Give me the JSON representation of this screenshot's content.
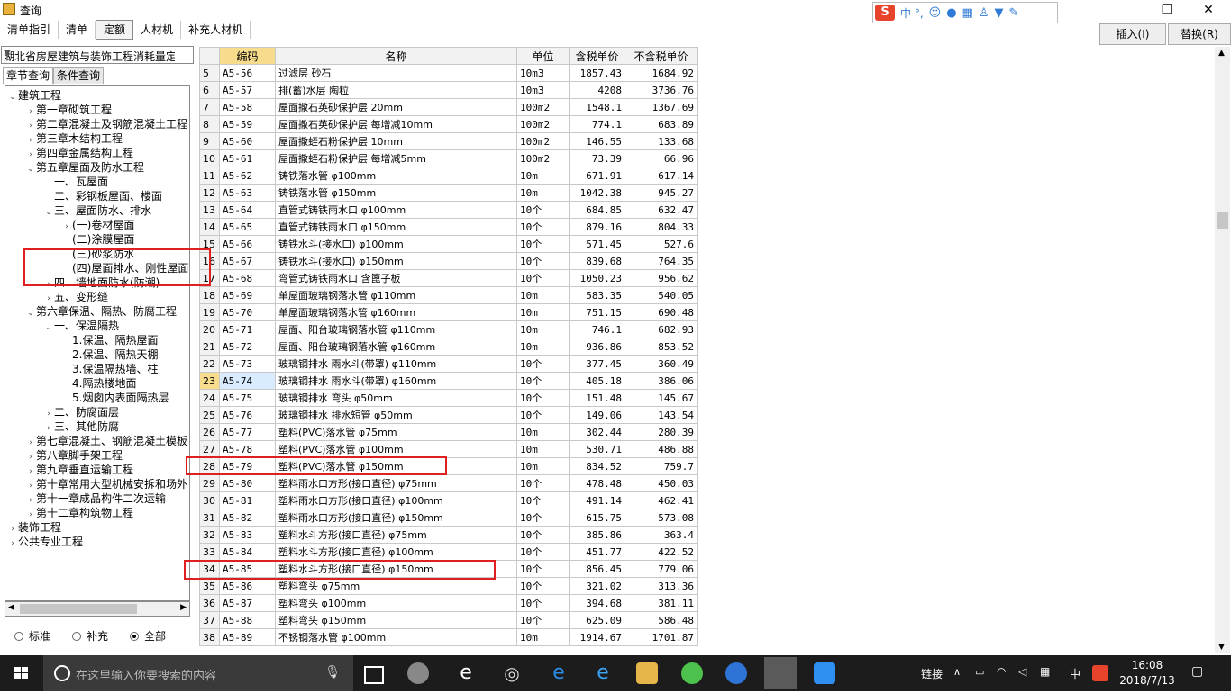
{
  "window": {
    "title": "查询"
  },
  "ime": {
    "brand": "S",
    "chars": "中 °,",
    "icons": [
      "emoji-icon",
      "mic-icon",
      "keyboard-icon",
      "user-icon",
      "shirt-icon",
      "wrench-icon"
    ]
  },
  "toolbar": {
    "tabs": [
      "清单指引",
      "清单",
      "定额",
      "人材机",
      "补充人材机"
    ],
    "active_tab": "定额",
    "insert_label": "插入(I)",
    "replace_label": "替换(R)"
  },
  "library": {
    "selected": "湖北省房屋建筑与装饰工程消耗量定"
  },
  "left_tabs": [
    "章节查询",
    "条件查询"
  ],
  "tree": [
    {
      "label": "建筑工程",
      "level": 0,
      "exp": "v"
    },
    {
      "label": "第一章砌筑工程",
      "level": 1,
      "exp": ">"
    },
    {
      "label": "第二章混凝土及钢筋混凝土工程",
      "level": 1,
      "exp": ">"
    },
    {
      "label": "第三章木结构工程",
      "level": 1,
      "exp": ">"
    },
    {
      "label": "第四章金属结构工程",
      "level": 1,
      "exp": ">"
    },
    {
      "label": "第五章屋面及防水工程",
      "level": 1,
      "exp": "v"
    },
    {
      "label": "一、瓦屋面",
      "level": 2,
      "exp": ""
    },
    {
      "label": "二、彩钢板屋面、楼面",
      "level": 2,
      "exp": ""
    },
    {
      "label": "三、屋面防水、排水",
      "level": 2,
      "exp": "v"
    },
    {
      "label": "(一)卷材屋面",
      "level": 3,
      "exp": ">"
    },
    {
      "label": "(二)涂膜屋面",
      "level": 3,
      "exp": ""
    },
    {
      "label": "(三)砂浆防水",
      "level": 3,
      "exp": ""
    },
    {
      "label": "(四)屋面排水、刚性屋面",
      "level": 3,
      "exp": ""
    },
    {
      "label": "四、墙地面防水(防潮)",
      "level": 2,
      "exp": ">"
    },
    {
      "label": "五、变形缝",
      "level": 2,
      "exp": ">"
    },
    {
      "label": "第六章保温、隔热、防腐工程",
      "level": 1,
      "exp": "v"
    },
    {
      "label": "一、保温隔热",
      "level": 2,
      "exp": "v"
    },
    {
      "label": "1.保温、隔热屋面",
      "level": 3,
      "exp": ""
    },
    {
      "label": "2.保温、隔热天棚",
      "level": 3,
      "exp": ""
    },
    {
      "label": "3.保温隔热墙、柱",
      "level": 3,
      "exp": ""
    },
    {
      "label": "4.隔热楼地面",
      "level": 3,
      "exp": ""
    },
    {
      "label": "5.烟囱内表面隔热层",
      "level": 3,
      "exp": ""
    },
    {
      "label": "二、防腐面层",
      "level": 2,
      "exp": ">"
    },
    {
      "label": "三、其他防腐",
      "level": 2,
      "exp": ">"
    },
    {
      "label": "第七章混凝土、钢筋混凝土模板",
      "level": 1,
      "exp": ">"
    },
    {
      "label": "第八章脚手架工程",
      "level": 1,
      "exp": ">"
    },
    {
      "label": "第九章垂直运输工程",
      "level": 1,
      "exp": ">"
    },
    {
      "label": "第十章常用大型机械安拆和场外",
      "level": 1,
      "exp": ">"
    },
    {
      "label": "第十一章成品构件二次运输",
      "level": 1,
      "exp": ">"
    },
    {
      "label": "第十二章构筑物工程",
      "level": 1,
      "exp": ">"
    },
    {
      "label": "装饰工程",
      "level": 0,
      "exp": ">"
    },
    {
      "label": "公共专业工程",
      "level": 0,
      "exp": ">"
    }
  ],
  "filters": {
    "options": [
      "标准",
      "补充",
      "全部"
    ],
    "selected": "全部"
  },
  "grid": {
    "headers": [
      "编码",
      "名称",
      "单位",
      "含税单价",
      "不含税单价"
    ],
    "selected_row": "23",
    "rows": [
      [
        "5",
        "A5-56",
        "过滤层 砂石",
        "10m3",
        "1857.43",
        "1684.92"
      ],
      [
        "6",
        "A5-57",
        "排(蓄)水层 陶粒",
        "10m3",
        "4208",
        "3736.76"
      ],
      [
        "7",
        "A5-58",
        "屋面撒石英砂保护层 20mm",
        "100m2",
        "1548.1",
        "1367.69"
      ],
      [
        "8",
        "A5-59",
        "屋面撒石英砂保护层 每增减10mm",
        "100m2",
        "774.1",
        "683.89"
      ],
      [
        "9",
        "A5-60",
        "屋面撒蛭石粉保护层 10mm",
        "100m2",
        "146.55",
        "133.68"
      ],
      [
        "10",
        "A5-61",
        "屋面撒蛭石粉保护层 每增减5mm",
        "100m2",
        "73.39",
        "66.96"
      ],
      [
        "11",
        "A5-62",
        "铸铁落水管 φ100mm",
        "10m",
        "671.91",
        "617.14"
      ],
      [
        "12",
        "A5-63",
        "铸铁落水管 φ150mm",
        "10m",
        "1042.38",
        "945.27"
      ],
      [
        "13",
        "A5-64",
        "直管式铸铁雨水口 φ100mm",
        "10个",
        "684.85",
        "632.47"
      ],
      [
        "14",
        "A5-65",
        "直管式铸铁雨水口 φ150mm",
        "10个",
        "879.16",
        "804.33"
      ],
      [
        "15",
        "A5-66",
        "铸铁水斗(接水口) φ100mm",
        "10个",
        "571.45",
        "527.6"
      ],
      [
        "16",
        "A5-67",
        "铸铁水斗(接水口) φ150mm",
        "10个",
        "839.68",
        "764.35"
      ],
      [
        "17",
        "A5-68",
        "弯管式铸铁雨水口 含篦子板",
        "10个",
        "1050.23",
        "956.62"
      ],
      [
        "18",
        "A5-69",
        "单屋面玻璃钢落水管 φ110mm",
        "10m",
        "583.35",
        "540.05"
      ],
      [
        "19",
        "A5-70",
        "单屋面玻璃钢落水管 φ160mm",
        "10m",
        "751.15",
        "690.48"
      ],
      [
        "20",
        "A5-71",
        "屋面、阳台玻璃钢落水管 φ110mm",
        "10m",
        "746.1",
        "682.93"
      ],
      [
        "21",
        "A5-72",
        "屋面、阳台玻璃钢落水管 φ160mm",
        "10m",
        "936.86",
        "853.52"
      ],
      [
        "22",
        "A5-73",
        "玻璃钢排水 雨水斗(带罩) φ110mm",
        "10个",
        "377.45",
        "360.49"
      ],
      [
        "23",
        "A5-74",
        "玻璃钢排水 雨水斗(带罩) φ160mm",
        "10个",
        "405.18",
        "386.06"
      ],
      [
        "24",
        "A5-75",
        "玻璃钢排水 弯头 φ50mm",
        "10个",
        "151.48",
        "145.67"
      ],
      [
        "25",
        "A5-76",
        "玻璃钢排水 排水短管 φ50mm",
        "10个",
        "149.06",
        "143.54"
      ],
      [
        "26",
        "A5-77",
        "塑料(PVC)落水管 φ75mm",
        "10m",
        "302.44",
        "280.39"
      ],
      [
        "27",
        "A5-78",
        "塑料(PVC)落水管 φ100mm",
        "10m",
        "530.71",
        "486.88"
      ],
      [
        "28",
        "A5-79",
        "塑料(PVC)落水管 φ150mm",
        "10m",
        "834.52",
        "759.7"
      ],
      [
        "29",
        "A5-80",
        "塑料雨水口方形(接口直径) φ75mm",
        "10个",
        "478.48",
        "450.03"
      ],
      [
        "30",
        "A5-81",
        "塑料雨水口方形(接口直径) φ100mm",
        "10个",
        "491.14",
        "462.41"
      ],
      [
        "31",
        "A5-82",
        "塑料雨水口方形(接口直径) φ150mm",
        "10个",
        "615.75",
        "573.08"
      ],
      [
        "32",
        "A5-83",
        "塑料水斗方形(接口直径) φ75mm",
        "10个",
        "385.86",
        "363.4"
      ],
      [
        "33",
        "A5-84",
        "塑料水斗方形(接口直径) φ100mm",
        "10个",
        "451.77",
        "422.52"
      ],
      [
        "34",
        "A5-85",
        "塑料水斗方形(接口直径) φ150mm",
        "10个",
        "856.45",
        "779.06"
      ],
      [
        "35",
        "A5-86",
        "塑料弯头 φ75mm",
        "10个",
        "321.02",
        "313.36"
      ],
      [
        "36",
        "A5-87",
        "塑料弯头 φ100mm",
        "10个",
        "394.68",
        "381.11"
      ],
      [
        "37",
        "A5-88",
        "塑料弯头 φ150mm",
        "10个",
        "625.09",
        "586.48"
      ],
      [
        "38",
        "A5-89",
        "不锈钢落水管 φ100mm",
        "10m",
        "1914.67",
        "1701.87"
      ]
    ]
  },
  "taskbar": {
    "search_placeholder": "在这里输入你要搜索的内容",
    "tray_text": "链接",
    "ime_tray": "中",
    "time": "16:08",
    "date": "2018/7/13"
  },
  "colors": {
    "highlight_box": "#e02020",
    "header_code": "#f6dc8c",
    "selected_cell": "#d9ebff",
    "taskbar": "#1c1c1c"
  }
}
